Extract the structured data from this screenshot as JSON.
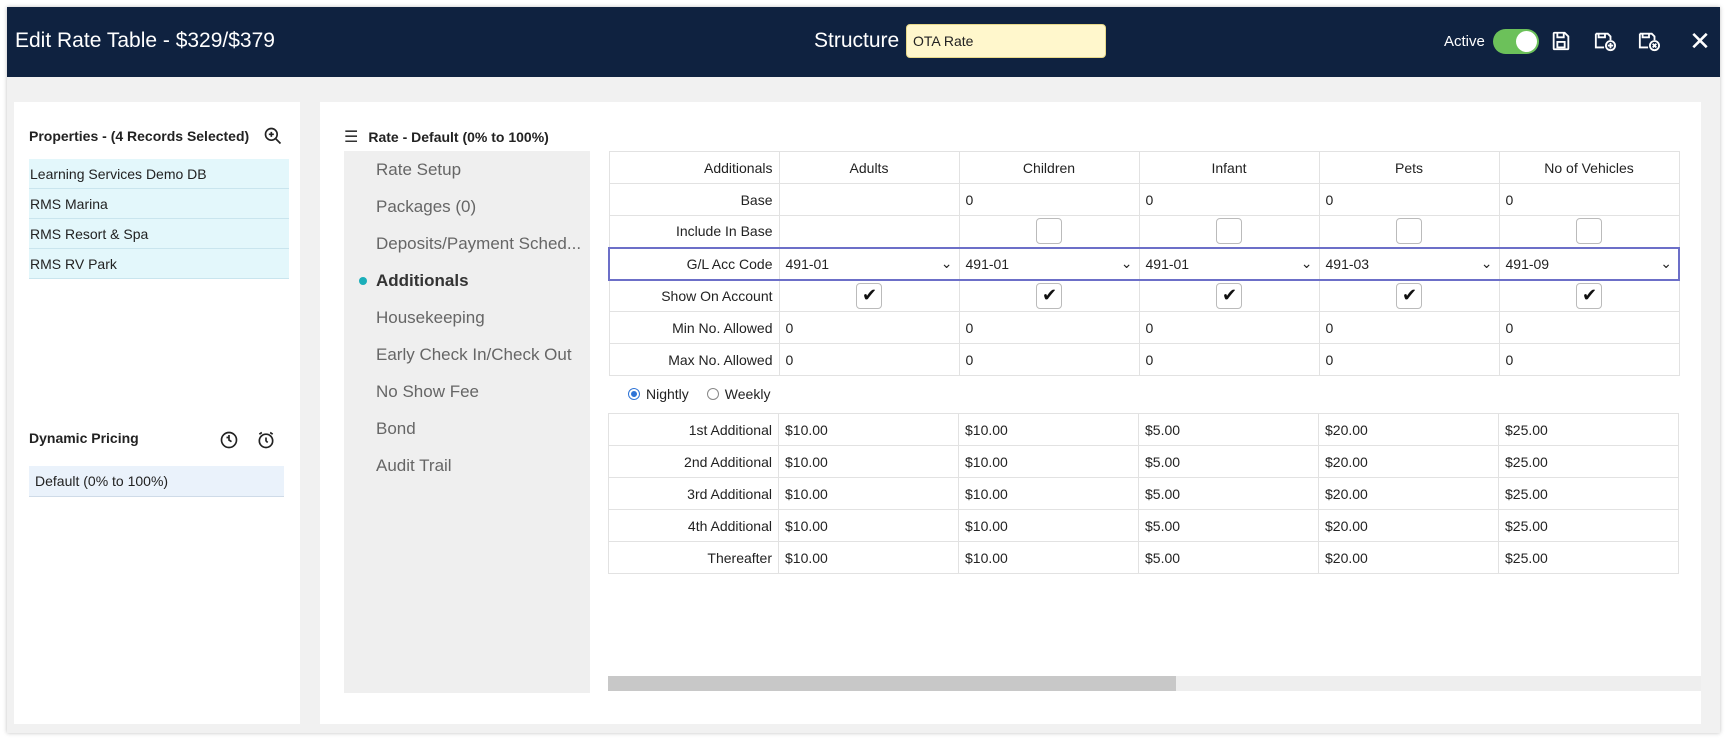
{
  "header": {
    "title": "Edit Rate Table - $329/$379",
    "structure_label": "Structure",
    "structure_value": "OTA Rate",
    "active_label": "Active"
  },
  "properties": {
    "title": "Properties - (4 Records Selected)",
    "items": [
      "Learning Services Demo DB",
      "RMS Marina",
      "RMS Resort & Spa",
      "RMS RV Park"
    ]
  },
  "dynamic_pricing": {
    "title": "Dynamic Pricing",
    "item": "Default (0% to 100%)"
  },
  "rate": {
    "title": "Rate - Default (0% to 100%)"
  },
  "nav": {
    "items": [
      "Rate Setup",
      "Packages (0)",
      "Deposits/Payment Sched...",
      "Additionals",
      "Housekeeping",
      "Early Check In/Check Out",
      "No Show Fee",
      "Bond",
      "Audit Trail"
    ],
    "active": "Additionals"
  },
  "table": {
    "corner": "Additionals",
    "columns": [
      "Adults",
      "Children",
      "Infant",
      "Pets",
      "No of Vehicles"
    ],
    "row_labels": {
      "base": "Base",
      "include_in_base": "Include In Base",
      "gl_acc_code": "G/L Acc Code",
      "show_on_account": "Show On Account",
      "min_allowed": "Min No. Allowed",
      "max_allowed": "Max No. Allowed"
    },
    "base": [
      "",
      "0",
      "0",
      "0",
      "0"
    ],
    "include_in_base": [
      null,
      false,
      false,
      false,
      false
    ],
    "gl_acc_code": [
      "491-01",
      "491-01",
      "491-01",
      "491-03",
      "491-09"
    ],
    "show_on_account": [
      true,
      true,
      true,
      true,
      true
    ],
    "min_allowed": [
      "0",
      "0",
      "0",
      "0",
      "0"
    ],
    "max_allowed": [
      "0",
      "0",
      "0",
      "0",
      "0"
    ]
  },
  "frequency": {
    "options": [
      "Nightly",
      "Weekly"
    ],
    "selected": "Nightly"
  },
  "pricing_table": {
    "rows": [
      {
        "label": "1st Additional",
        "values": [
          "$10.00",
          "$10.00",
          "$5.00",
          "$20.00",
          "$25.00"
        ]
      },
      {
        "label": "2nd Additional",
        "values": [
          "$10.00",
          "$10.00",
          "$5.00",
          "$20.00",
          "$25.00"
        ]
      },
      {
        "label": "3rd Additional",
        "values": [
          "$10.00",
          "$10.00",
          "$5.00",
          "$20.00",
          "$25.00"
        ]
      },
      {
        "label": "4th Additional",
        "values": [
          "$10.00",
          "$10.00",
          "$5.00",
          "$20.00",
          "$25.00"
        ]
      },
      {
        "label": "Thereafter",
        "values": [
          "$10.00",
          "$10.00",
          "$5.00",
          "$20.00",
          "$25.00"
        ]
      }
    ]
  },
  "colors": {
    "header_bg": "#0f2240",
    "toggle_on": "#6cc15a",
    "active_dot": "#1aaeb9",
    "highlight_row_border": "#6c6fc8",
    "structure_input_bg": "#fff7cc"
  },
  "icons": [
    "save-icon",
    "save-and-new-icon",
    "save-and-close-icon",
    "close-icon",
    "zoom-in-icon",
    "dynamic-pricing-icon",
    "alarm-clock-icon",
    "hamburger-menu-icon",
    "chevron-down-icon",
    "checkmark-icon"
  ]
}
